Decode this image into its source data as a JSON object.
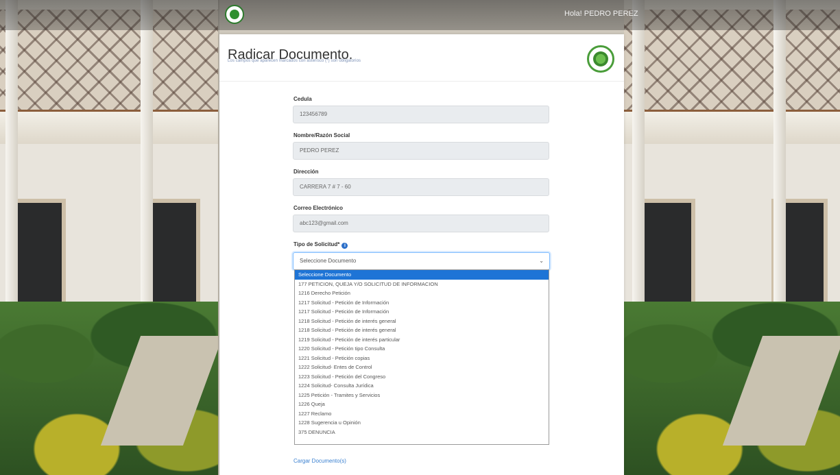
{
  "navbar": {
    "user_greeting": "Hola! PEDRO PEREZ"
  },
  "header": {
    "title": "Radicar Documento.",
    "subtitle": "Los campos que aparecen marcados con asterisco (*) son obligatorios"
  },
  "form": {
    "cedula": {
      "label": "Cedula",
      "value": "123456789"
    },
    "nombre": {
      "label": "Nombre/Razón Social",
      "value": "PEDRO PEREZ"
    },
    "direccion": {
      "label": "Dirección",
      "value": "CARRERA 7 # 7 - 60"
    },
    "correo": {
      "label": "Correo Electrónico",
      "value": "abc123@gmail.com"
    },
    "tipo_solicitud": {
      "label": "Tipo de Solicitud*",
      "selected": "Seleccione Documento",
      "options": [
        "Seleccione Documento",
        "177 PETICION, QUEJA Y/O SOLICITUD DE INFORMACION",
        "1216 Derecho Petición",
        "1217 Solicitud - Petición de Información",
        "1217 Solicitud - Petición de Información",
        "1218 Solicitud - Petición de interés general",
        "1218 Solicitud - Petición de interés general",
        "1219 Solicitud - Petición de interés particular",
        "1220 Solicitud - Petición tipo Consulta",
        "1221 Solicitud - Petición copias",
        "1222 Solicitud- Entes de Control",
        "1223 Solicitud - Petición del Congreso",
        "1224 Solicitud- Consulta Jurídica",
        "1225 Petición - Tramites y Servicios",
        "1226 Queja",
        "1227 Reclamo",
        "1228 Sugerencia u Opinión",
        "375 DENUNCIA"
      ]
    },
    "upload_link": "Cargar Documento(s)"
  }
}
